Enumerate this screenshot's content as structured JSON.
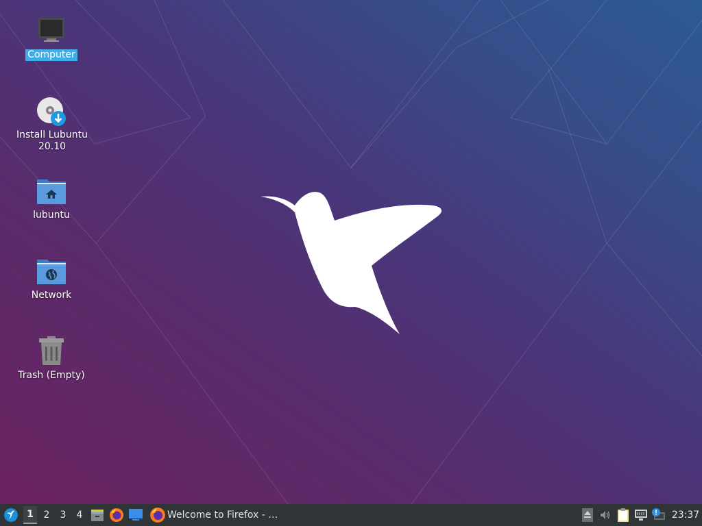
{
  "desktop": {
    "icons": [
      {
        "label": "Computer",
        "icon": "computer-icon",
        "selected": true
      },
      {
        "label": "Install Lubuntu 20.10",
        "icon": "install-disc-icon",
        "selected": false
      },
      {
        "label": "lubuntu",
        "icon": "home-folder-icon",
        "selected": false
      },
      {
        "label": "Network",
        "icon": "network-folder-icon",
        "selected": false
      },
      {
        "label": "Trash (Empty)",
        "icon": "trash-icon",
        "selected": false
      }
    ],
    "wallpaper": "lubuntu-hummingbird"
  },
  "taskbar": {
    "start_icon": "lubuntu-start-icon",
    "workspaces": [
      "1",
      "2",
      "3",
      "4"
    ],
    "active_workspace": "1",
    "quicklaunch": [
      "file-manager-icon",
      "firefox-icon",
      "show-desktop-icon"
    ],
    "tasks": [
      {
        "title": "Welcome to Firefox - …",
        "icon": "firefox-icon"
      }
    ],
    "tray": [
      "eject-icon",
      "volume-icon",
      "clipboard-icon",
      "network-icon",
      "update-notifier-icon"
    ],
    "clock": "23:37"
  },
  "colors": {
    "selection": "#3daee9",
    "taskbar_bg": "#2f3437",
    "folder_blue": "#4a90d9"
  }
}
